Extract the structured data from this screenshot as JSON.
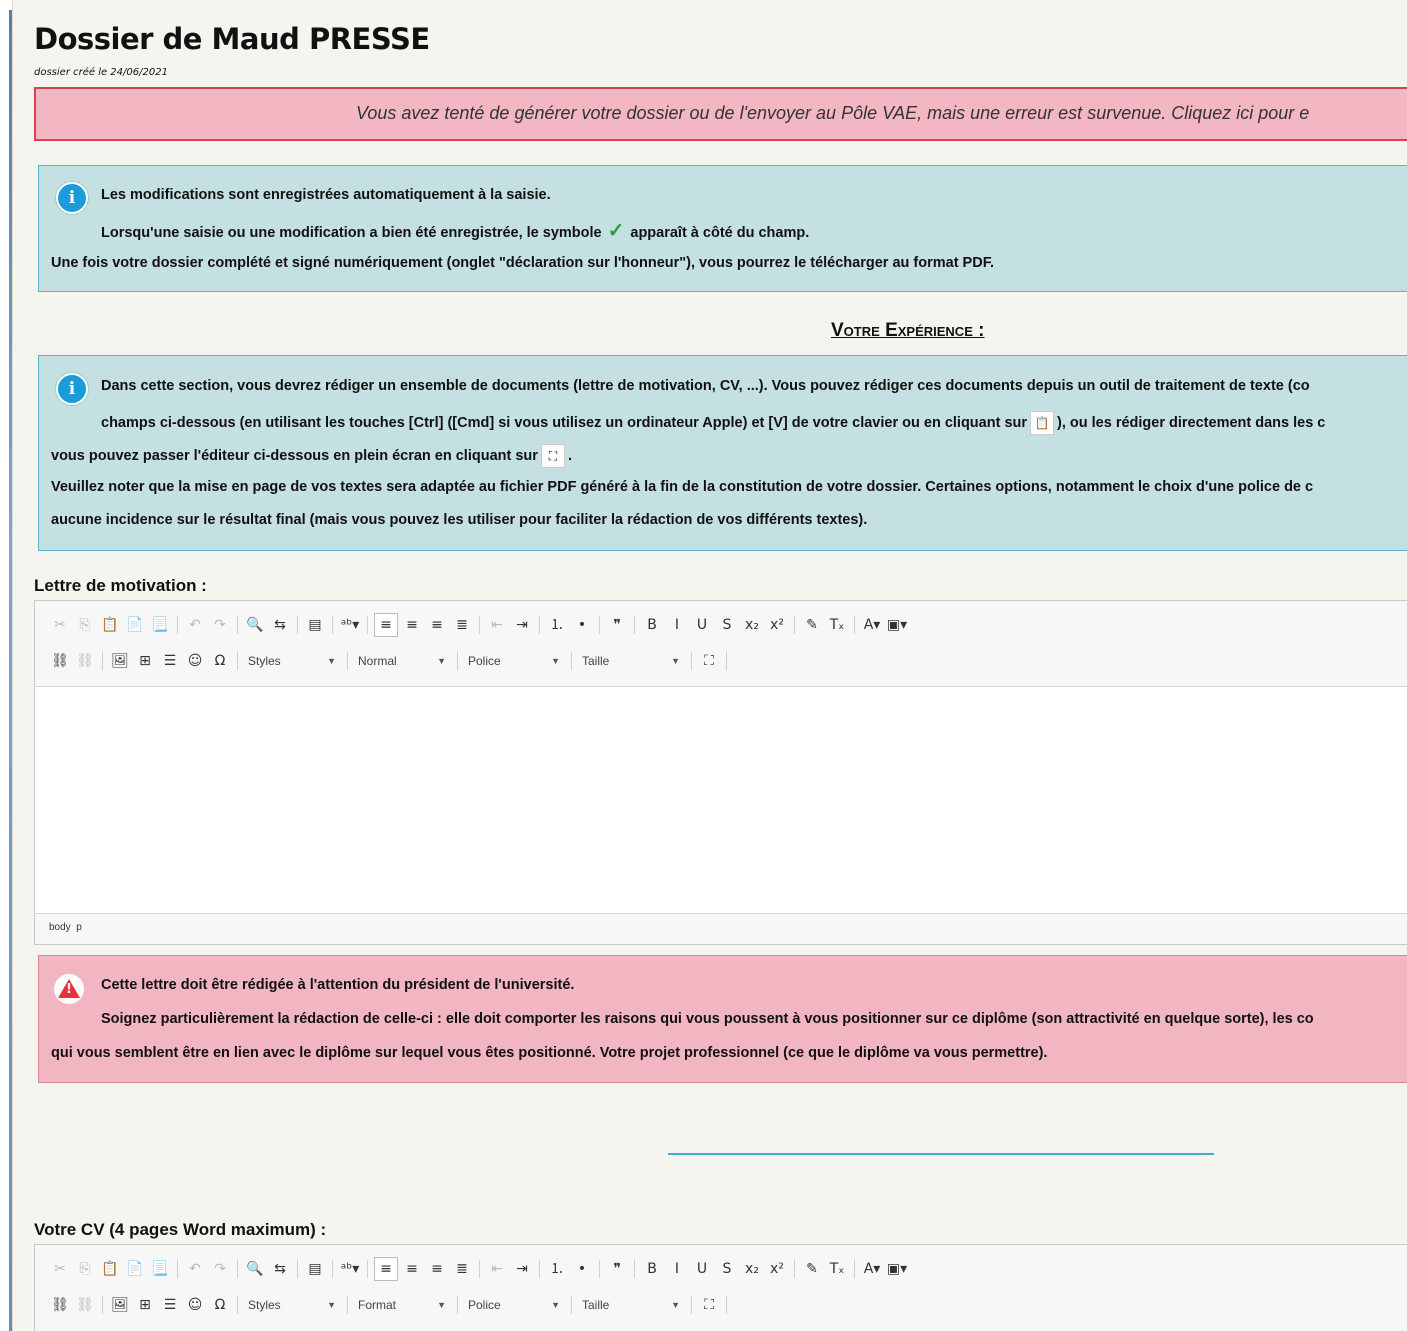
{
  "page": {
    "title": "Dossier de Maud PRESSE",
    "created": "dossier créé le 24/06/2021"
  },
  "error_banner": {
    "text": "Vous avez tenté de générer votre dossier ou de l'envoyer au Pôle VAE, mais une erreur est survenue. Cliquez ici pour e"
  },
  "info1": {
    "line1": "Les modifications sont enregistrées automatiquement à la saisie.",
    "line2a": "Lorsqu'une saisie ou une modification a bien été enregistrée, le symbole",
    "check_icon": "check-icon",
    "line2b": "apparaît à côté du champ.",
    "line3": "Une fois votre dossier complété et signé numériquement (onglet \"déclaration sur l'honneur\"), vous pourrez le télécharger au format PDF."
  },
  "section_heading": "Votre Expérience :",
  "info2": {
    "line1": "Dans cette section, vous devrez rédiger un ensemble de documents (lettre de motivation, CV, ...). Vous pouvez rédiger ces documents depuis un outil de traitement de texte (co",
    "line2a": "champs ci-dessous (en utilisant les touches [Ctrl] ([Cmd] si vous utilisez un ordinateur Apple) et [V] de votre clavier ou en cliquant sur",
    "line2b": "), ou les rédiger directement dans les c",
    "line3a": "vous pouvez passer l'éditeur ci-dessous en plein écran en cliquant sur",
    "line3b": ".",
    "line4": "Veuillez noter que la mise en page de vos textes sera adaptée au fichier PDF généré à la fin de la constitution de votre dossier. Certaines options, notamment le choix d'une police de c",
    "line5": "aucune incidence sur le résultat final (mais vous pouvez les utiliser pour faciliter la rédaction de vos différents textes)."
  },
  "editor1": {
    "label": "Lettre de motivation :",
    "format_combo": "Normal",
    "path_body": "body",
    "path_p": "p"
  },
  "editor_common": {
    "styles": "Styles",
    "police": "Police",
    "taille": "Taille"
  },
  "warning": {
    "line1": "Cette lettre doit être rédigée à l'attention du président de l'université.",
    "line2": "Soignez particulièrement la rédaction de celle-ci : elle doit comporter les raisons qui vous poussent à vous positionner sur ce diplôme (son attractivité en quelque sorte), les co",
    "line3": "qui vous semblent être en lien avec le diplôme sur lequel vous êtes positionné. Votre projet professionnel (ce que le diplôme va vous permettre)."
  },
  "editor2": {
    "label": "Votre CV (4 pages Word maximum) :",
    "format_combo": "Format"
  },
  "toolbar": {
    "row1": [
      {
        "name": "cut-icon",
        "glyph": "✂",
        "dim": true
      },
      {
        "name": "copy-icon",
        "glyph": "⎘",
        "dim": true
      },
      {
        "name": "paste-icon",
        "glyph": "📋",
        "dim": false
      },
      {
        "name": "paste-text-icon",
        "glyph": "📄",
        "dim": false
      },
      {
        "name": "paste-word-icon",
        "glyph": "📃",
        "dim": false
      },
      {
        "sep": true
      },
      {
        "name": "undo-icon",
        "glyph": "↶",
        "dim": true
      },
      {
        "name": "redo-icon",
        "glyph": "↷",
        "dim": true
      },
      {
        "sep": true
      },
      {
        "name": "find-icon",
        "glyph": "🔍",
        "dim": false
      },
      {
        "name": "replace-icon",
        "glyph": "⇆",
        "dim": false
      },
      {
        "sep": true
      },
      {
        "name": "select-all-icon",
        "glyph": "▤",
        "dim": false
      },
      {
        "sep": true
      },
      {
        "name": "spellcheck-icon",
        "glyph": "ᵃᵇ▾",
        "dim": false
      },
      {
        "sep": true
      },
      {
        "name": "align-left-icon",
        "glyph": "≡",
        "dim": false,
        "active": true
      },
      {
        "name": "align-center-icon",
        "glyph": "≡",
        "dim": false
      },
      {
        "name": "align-right-icon",
        "glyph": "≡",
        "dim": false
      },
      {
        "name": "justify-icon",
        "glyph": "≣",
        "dim": false
      },
      {
        "sep": true
      },
      {
        "name": "outdent-icon",
        "glyph": "⇤",
        "dim": true
      },
      {
        "name": "indent-icon",
        "glyph": "⇥",
        "dim": false
      },
      {
        "sep": true
      },
      {
        "name": "numbered-list-icon",
        "glyph": "⒈",
        "dim": false
      },
      {
        "name": "bullet-list-icon",
        "glyph": "•",
        "dim": false
      },
      {
        "sep": true
      },
      {
        "name": "blockquote-icon",
        "glyph": "❞",
        "dim": false
      },
      {
        "sep": true
      },
      {
        "name": "bold-icon",
        "glyph": "B",
        "dim": false
      },
      {
        "name": "italic-icon",
        "glyph": "I",
        "dim": false
      },
      {
        "name": "underline-icon",
        "glyph": "U",
        "dim": false
      },
      {
        "name": "strike-icon",
        "glyph": "S",
        "dim": false
      },
      {
        "name": "subscript-icon",
        "glyph": "x₂",
        "dim": false
      },
      {
        "name": "superscript-icon",
        "glyph": "x²",
        "dim": false
      },
      {
        "sep": true
      },
      {
        "name": "copy-format-icon",
        "glyph": "✎",
        "dim": false
      },
      {
        "name": "remove-format-icon",
        "glyph": "Tₓ",
        "dim": false
      },
      {
        "sep": true
      },
      {
        "name": "text-color-icon",
        "glyph": "A▾",
        "dim": false
      },
      {
        "name": "bg-color-icon",
        "glyph": "▣▾",
        "dim": false
      }
    ],
    "row2_left": [
      {
        "name": "link-icon",
        "glyph": "⛓",
        "dim": false
      },
      {
        "name": "unlink-icon",
        "glyph": "⛓",
        "dim": true
      },
      {
        "sep": true
      },
      {
        "name": "image-icon",
        "glyph": "🖼",
        "dim": false
      },
      {
        "name": "table-icon",
        "glyph": "⊞",
        "dim": false
      },
      {
        "name": "horizontal-rule-icon",
        "glyph": "☰",
        "dim": false
      },
      {
        "name": "smiley-icon",
        "glyph": "☺",
        "dim": false
      },
      {
        "name": "special-char-icon",
        "glyph": "Ω",
        "dim": false
      },
      {
        "sep": true
      }
    ],
    "maximize_icon": "maximize-icon"
  }
}
